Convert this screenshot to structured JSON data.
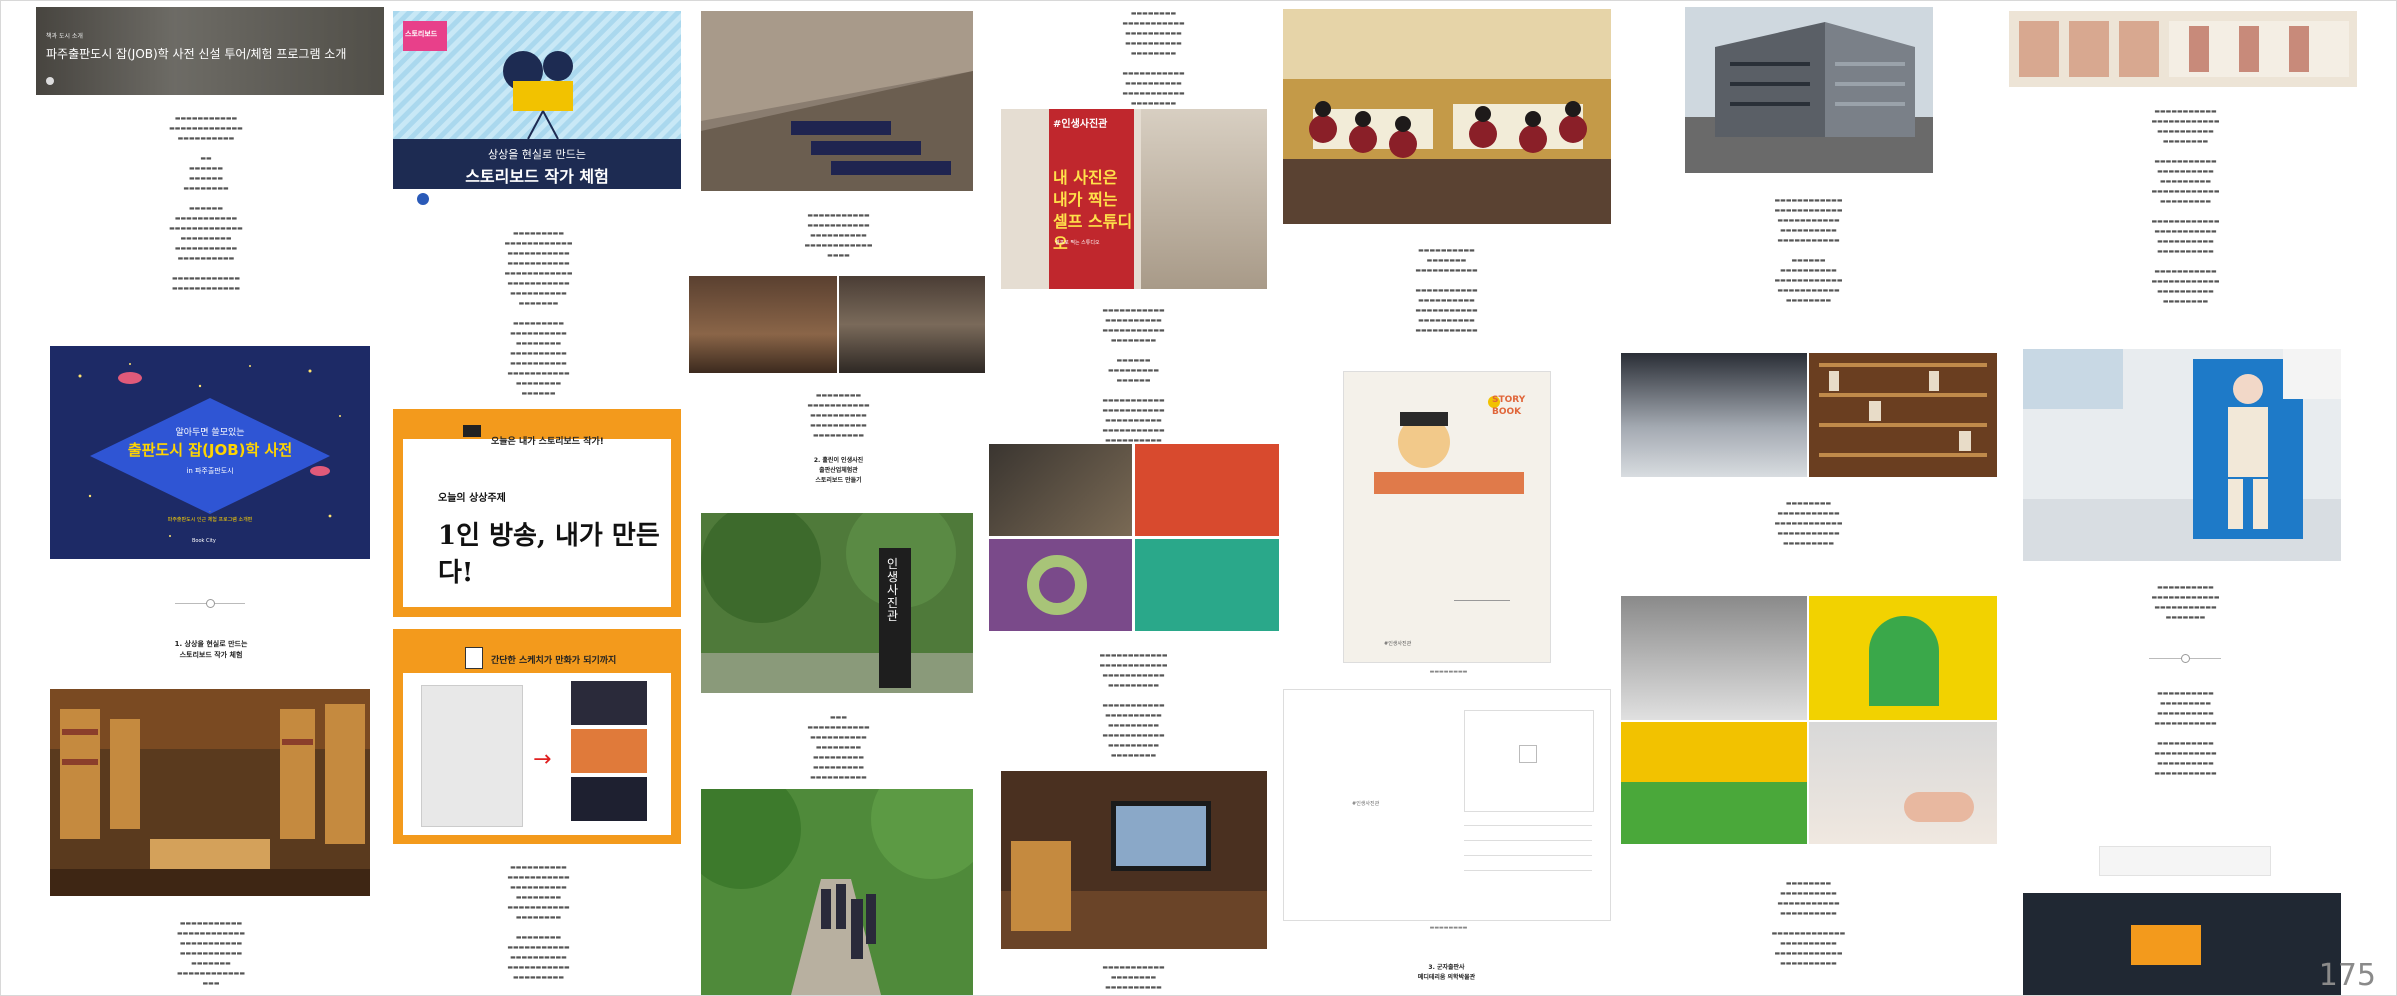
{
  "page_number": "175",
  "col1": {
    "banner_title": "파주출판도시 잡(JOB)학 사전 신설 투어/체험 프로그램 소개",
    "banner_tag": "책과 도시 소개",
    "poster_title": "알아두면 쓸모있는",
    "poster_main": "출판도시 잡(JOB)학 사전",
    "poster_sub": "in 파주출판도시",
    "poster_note": "파주출판도시 인근 체험 프로그램 소개편",
    "poster_logo": "Book City",
    "section1": "1. 상상을 현실로 만드는\n스토리보드 작가 체험"
  },
  "col2": {
    "poster_badge": "스토리보드",
    "poster_head_1": "상상을 현실로 만드는",
    "poster_head_2": "스토리보드 작가 체험",
    "card1_title": "오늘은 내가 스토리보드 작가!",
    "card1_big_1": "오늘의 상상주제",
    "card1_big_2": "1인 방송, 내가 만든다!",
    "card2_title": "간단한 스케치가 만화가 되기까지"
  },
  "col3": {
    "section2": "2. 훌린이 인생사진\n출판산업체험관\n스토리보드 만들기",
    "sign": "인생사진관"
  },
  "col4": {
    "sign_tag": "#인생사진관",
    "sign_big": "내 사진은\n내가 찍는\n셀프 스튜디오",
    "sign_sub": "셀프로 찍는 스튜디오"
  },
  "col5": {
    "book_title": "STORY BOOK",
    "tag": "#인생사진관",
    "section3": "3. 군자출판사\n메디테리움 의학박물관"
  },
  "colors": {
    "navy": "#1d2b52",
    "orange": "#f39a1c",
    "red": "#c0272d",
    "sky": "#bfe3f4"
  }
}
